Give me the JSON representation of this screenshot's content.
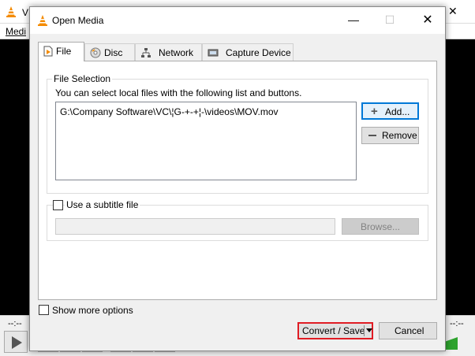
{
  "background_window": {
    "title": "V",
    "menu_first": "Medi",
    "time_left": "--:--",
    "time_right": "--:--"
  },
  "dialog": {
    "title": "Open Media",
    "tabs": [
      {
        "label": "File",
        "icon": "file-icon",
        "active": true
      },
      {
        "label": "Disc",
        "icon": "disc-icon",
        "active": false
      },
      {
        "label": "Network",
        "icon": "network-icon",
        "active": false
      },
      {
        "label": "Capture Device",
        "icon": "capture-device-icon",
        "active": false
      }
    ],
    "file_selection": {
      "group_label": "File Selection",
      "description": "You can select local files with the following list and buttons.",
      "files": [
        "G:\\Company Software\\VC\\¦G-+-+¦-\\videos\\MOV.mov"
      ],
      "add_label": "Add...",
      "remove_label": "Remove"
    },
    "subtitle": {
      "checkbox_label": "Use a subtitle file",
      "checked": false,
      "path_value": "",
      "browse_label": "Browse..."
    },
    "show_more_options": {
      "label": "Show more options",
      "checked": false
    },
    "convert_save_label": "Convert / Save",
    "cancel_label": "Cancel"
  },
  "colors": {
    "highlight_border": "#e01c24",
    "focus_border": "#0078d7",
    "vlc_orange": "#f48b00",
    "volume_green": "#2ea32e"
  }
}
